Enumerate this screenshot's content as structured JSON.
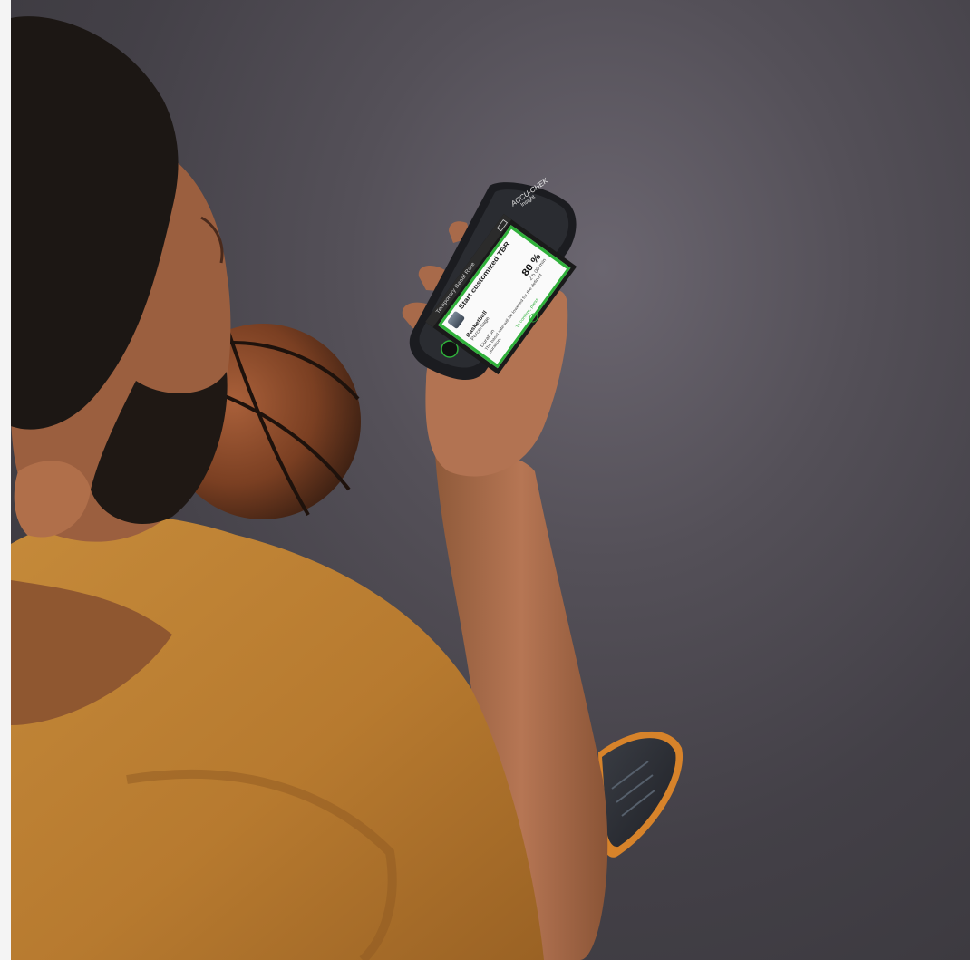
{
  "phone": {
    "brand": "ACCU-CHEK",
    "model": "Insight",
    "status_title": "Temporary Basal Rate",
    "screen_title": "Start customized TBR",
    "profile_name": "Basketball",
    "percentage_label": "Percentage",
    "percentage_value": "80 %",
    "duration_label": "Duration",
    "duration_value": "2 h 00 min",
    "note": "The basal rate will be lowered for the defined duration.",
    "confirm_text": "To confirm, press",
    "accent_color": "#2fb13a"
  }
}
